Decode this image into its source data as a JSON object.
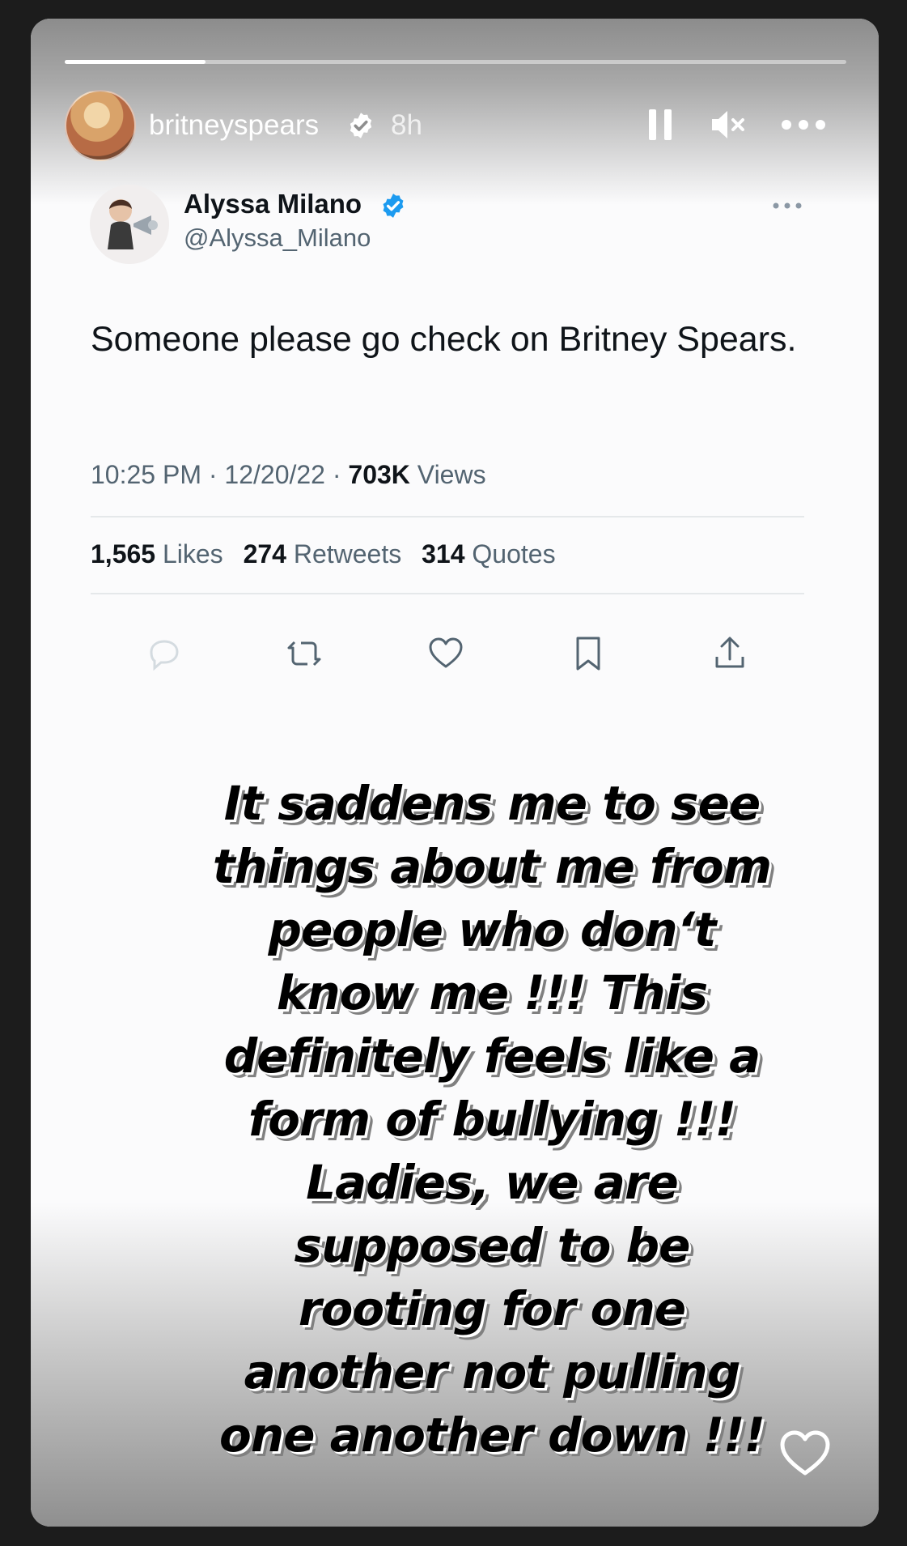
{
  "story": {
    "username": "britneyspears",
    "time_ago": "8h",
    "progress_fraction": 0.18
  },
  "tweet": {
    "name": "Alyssa Milano",
    "handle": "@Alyssa_Milano",
    "text": "Someone please go check on Britney Spears.",
    "time": "10:25 PM",
    "date": "12/20/22",
    "views_count": "703K",
    "views_label": "Views",
    "separator": "·",
    "likes_count": "1,565",
    "likes_label": "Likes",
    "retweets_count": "274",
    "retweets_label": "Retweets",
    "quotes_count": "314",
    "quotes_label": "Quotes"
  },
  "caption_lines": [
    "It saddens me to see",
    "things about me from",
    "people who don‘t",
    "know me !!! This",
    "definitely feels like a",
    "form of bullying !!!",
    "Ladies, we are",
    "supposed to be",
    "rooting for one",
    "another not pulling",
    "one another down !!!"
  ],
  "icons": {
    "verified": "verified-badge-icon",
    "pause": "pause-icon",
    "mute": "mute-icon",
    "more": "more-icon",
    "reply": "reply-icon",
    "retweet": "retweet-icon",
    "like": "heart-icon",
    "bookmark": "bookmark-icon",
    "share": "share-icon"
  },
  "colors": {
    "twitter_blue": "#1d9bf0",
    "tweet_text": "#0f1419",
    "tweet_secondary": "#536471"
  }
}
